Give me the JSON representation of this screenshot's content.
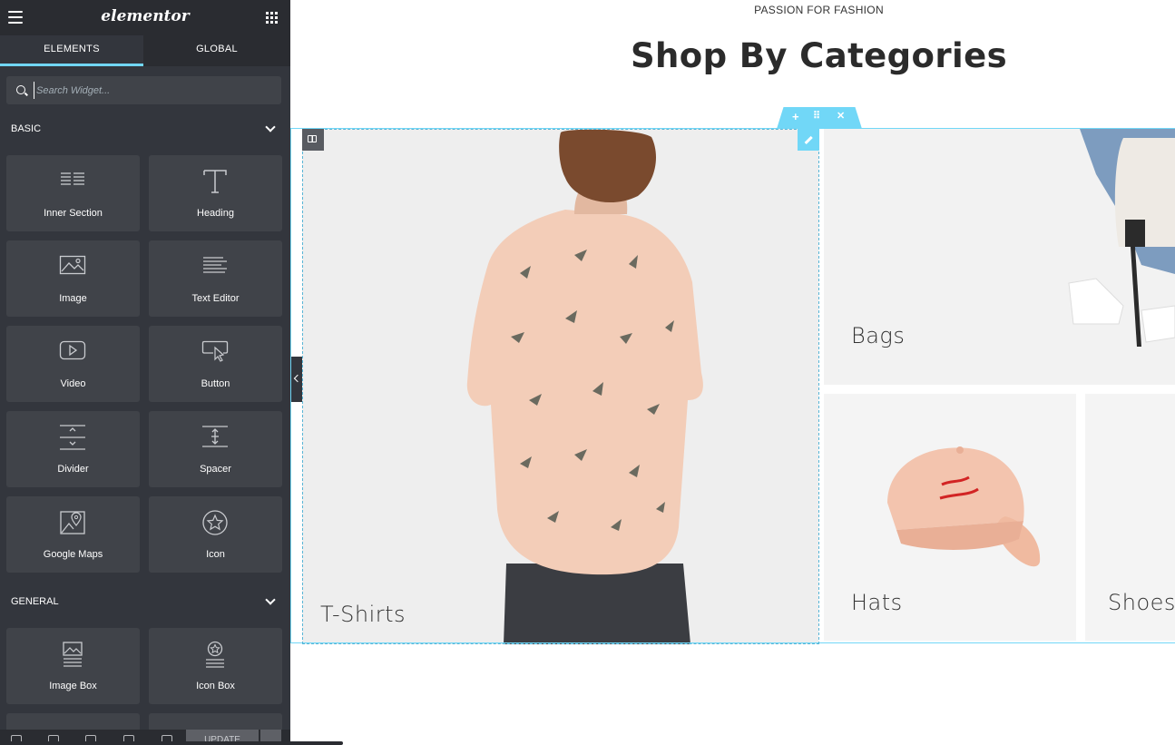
{
  "app": {
    "logo": "elementor",
    "menu_icon": "hamburger-icon",
    "apps_icon": "grid-icon"
  },
  "tabs": [
    {
      "label": "ELEMENTS",
      "active": true
    },
    {
      "label": "GLOBAL",
      "active": false
    }
  ],
  "search": {
    "placeholder": "Search Widget..."
  },
  "categories": {
    "basic": "BASIC",
    "general": "GENERAL"
  },
  "widgets": {
    "inner_section": "Inner Section",
    "heading": "Heading",
    "image": "Image",
    "text_editor": "Text Editor",
    "video": "Video",
    "button": "Button",
    "divider": "Divider",
    "spacer": "Spacer",
    "google_maps": "Google Maps",
    "icon": "Icon",
    "image_box": "Image Box",
    "icon_box": "Icon Box"
  },
  "footer": {
    "update_label": "UPDATE"
  },
  "canvas": {
    "subtitle": "PASSION FOR FASHION",
    "title": "Shop By Categories",
    "section_controls": {
      "add": "+",
      "move": "⠿",
      "delete": "✕"
    },
    "tiles": {
      "tshirts": "T-Shirts",
      "bags": "Bags",
      "hats": "Hats",
      "shoes": "Shoes"
    }
  },
  "colors": {
    "accent": "#71d7f7",
    "panel": "#33363d",
    "panel_dark": "#2a2c31",
    "widget_bg": "#404349"
  }
}
